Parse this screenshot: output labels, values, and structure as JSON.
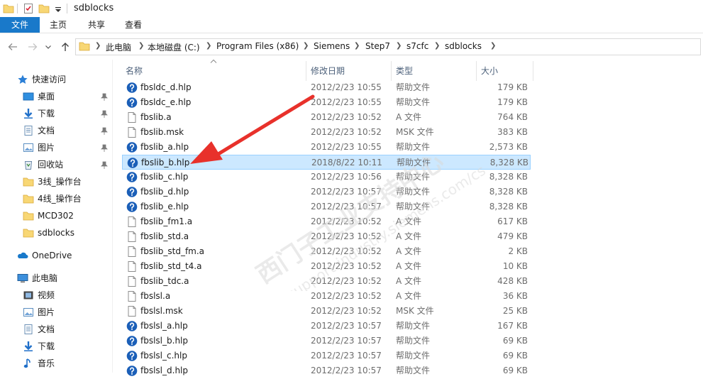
{
  "window": {
    "title": "sdblocks"
  },
  "ribbon": {
    "tabs": [
      "文件",
      "主页",
      "共享",
      "查看"
    ]
  },
  "address": {
    "crumbs": [
      "此电脑",
      "本地磁盘 (C:)",
      "Program Files (x86)",
      "Siemens",
      "Step7",
      "s7cfc",
      "sdblocks"
    ]
  },
  "sidebar": {
    "items": [
      {
        "label": "快速访问",
        "icon": "star-icon"
      },
      {
        "label": "桌面",
        "icon": "desktop-icon",
        "pinned": true
      },
      {
        "label": "下载",
        "icon": "download-icon",
        "pinned": true
      },
      {
        "label": "文档",
        "icon": "documents-icon",
        "pinned": true
      },
      {
        "label": "图片",
        "icon": "pictures-icon",
        "pinned": true
      },
      {
        "label": "回收站",
        "icon": "recycle-bin-icon",
        "pinned": true
      },
      {
        "label": "3线_操作台",
        "icon": "folder-icon"
      },
      {
        "label": "4线_操作台",
        "icon": "folder-icon"
      },
      {
        "label": "MCD302",
        "icon": "folder-icon"
      },
      {
        "label": "sdblocks",
        "icon": "folder-icon"
      },
      {
        "label": "OneDrive",
        "icon": "onedrive-icon"
      },
      {
        "label": "此电脑",
        "icon": "computer-icon"
      },
      {
        "label": "视频",
        "icon": "videos-icon"
      },
      {
        "label": "图片",
        "icon": "pictures-icon"
      },
      {
        "label": "文档",
        "icon": "documents-icon"
      },
      {
        "label": "下载",
        "icon": "download-icon"
      },
      {
        "label": "音乐",
        "icon": "music-icon"
      }
    ]
  },
  "table": {
    "headers": [
      "名称",
      "修改日期",
      "类型",
      "大小"
    ],
    "rows": [
      {
        "name": "fbsldc_d.hlp",
        "date": "2012/2/23 10:55",
        "type": "帮助文件",
        "size": "179 KB",
        "icon": "help-file-icon"
      },
      {
        "name": "fbsldc_e.hlp",
        "date": "2012/2/23 10:55",
        "type": "帮助文件",
        "size": "179 KB",
        "icon": "help-file-icon"
      },
      {
        "name": "fbslib.a",
        "date": "2012/2/23 10:52",
        "type": "A 文件",
        "size": "764 KB",
        "icon": "file-icon"
      },
      {
        "name": "fbslib.msk",
        "date": "2012/2/23 10:52",
        "type": "MSK 文件",
        "size": "383 KB",
        "icon": "file-icon"
      },
      {
        "name": "fbslib_a.hlp",
        "date": "2012/2/23 10:55",
        "type": "帮助文件",
        "size": "2,573 KB",
        "icon": "help-file-icon"
      },
      {
        "name": "fbslib_b.hlp",
        "date": "2018/8/22 10:11",
        "type": "帮助文件",
        "size": "8,328 KB",
        "icon": "help-file-icon",
        "selected": true
      },
      {
        "name": "fbslib_c.hlp",
        "date": "2012/2/23 10:56",
        "type": "帮助文件",
        "size": "8,328 KB",
        "icon": "help-file-icon"
      },
      {
        "name": "fbslib_d.hlp",
        "date": "2012/2/23 10:57",
        "type": "帮助文件",
        "size": "8,328 KB",
        "icon": "help-file-icon"
      },
      {
        "name": "fbslib_e.hlp",
        "date": "2012/2/23 10:57",
        "type": "帮助文件",
        "size": "8,328 KB",
        "icon": "help-file-icon"
      },
      {
        "name": "fbslib_fm1.a",
        "date": "2012/2/23 10:52",
        "type": "A 文件",
        "size": "617 KB",
        "icon": "file-icon"
      },
      {
        "name": "fbslib_std.a",
        "date": "2012/2/23 10:52",
        "type": "A 文件",
        "size": "479 KB",
        "icon": "file-icon"
      },
      {
        "name": "fbslib_std_fm.a",
        "date": "2012/2/23 10:52",
        "type": "A 文件",
        "size": "2 KB",
        "icon": "file-icon"
      },
      {
        "name": "fbslib_std_t4.a",
        "date": "2012/2/23 10:52",
        "type": "A 文件",
        "size": "10 KB",
        "icon": "file-icon"
      },
      {
        "name": "fbslib_tdc.a",
        "date": "2012/2/23 10:52",
        "type": "A 文件",
        "size": "428 KB",
        "icon": "file-icon"
      },
      {
        "name": "fbslsl.a",
        "date": "2012/2/23 10:52",
        "type": "A 文件",
        "size": "36 KB",
        "icon": "file-icon"
      },
      {
        "name": "fbslsl.msk",
        "date": "2012/2/23 10:52",
        "type": "MSK 文件",
        "size": "25 KB",
        "icon": "file-icon"
      },
      {
        "name": "fbslsl_a.hlp",
        "date": "2012/2/23 10:57",
        "type": "帮助文件",
        "size": "167 KB",
        "icon": "help-file-icon"
      },
      {
        "name": "fbslsl_b.hlp",
        "date": "2012/2/23 10:57",
        "type": "帮助文件",
        "size": "69 KB",
        "icon": "help-file-icon"
      },
      {
        "name": "fbslsl_c.hlp",
        "date": "2012/2/23 10:57",
        "type": "帮助文件",
        "size": "69 KB",
        "icon": "help-file-icon"
      },
      {
        "name": "fbslsl_d.hlp",
        "date": "2012/2/23 10:57",
        "type": "帮助文件",
        "size": "69 KB",
        "icon": "help-file-icon"
      }
    ]
  },
  "watermark": {
    "line1": "西门子工业支持中心",
    "line2": "support.industry.siemens.com/cs"
  },
  "colors": {
    "accent": "#1979ca",
    "selection_bg": "#cce8ff",
    "selection_border": "#99d1ff",
    "annotation_arrow": "#e8312b",
    "help_icon": "#1b5fb8",
    "folder": "#f8d775"
  }
}
